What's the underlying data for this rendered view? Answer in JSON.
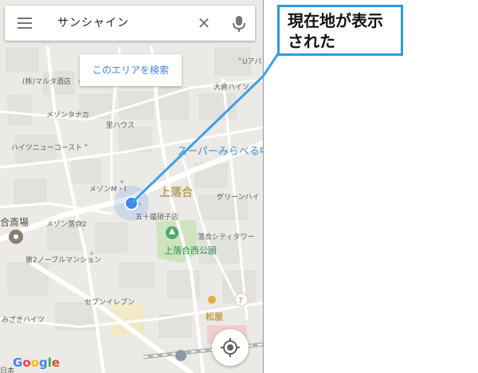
{
  "search_bar": {
    "query": "サンシャイン",
    "menu_icon": "hamburger-menu-icon",
    "clear_icon": "close-icon",
    "mic_icon": "microphone-icon",
    "clear_glyph": "✕"
  },
  "area_search": {
    "label": "このエリアを検索"
  },
  "map": {
    "places": {
      "marutaka": "(株)マルタ酒店",
      "mezon_tanaka": "メゾンタナカ",
      "sato_house": "里ハウス",
      "heights_new_coast": "ハイツニューコースト",
      "mezon_m": "メゾンM・I",
      "gojuarashi": "五十嵐硝子店",
      "mezon_ochiai": "メゾン落合2",
      "ochiai_hall": "合斎場",
      "noble_mansion": "第2ノーブルマンション",
      "seven_eleven": "セブンイレブン",
      "misaki_heights": "みざきハイツ",
      "green_heights": "グリーンハイ",
      "ochiai_city_tower": "落合シティタワー",
      "omiya_heights": "大倉ハイツ",
      "u_apa": "Uアパ",
      "nippon_fragment": "日本"
    },
    "area_label": "上落合",
    "park_label": "上落合西公園",
    "store_label": "スーパーみらべる中",
    "matsuya_label": "松屋"
  },
  "branding": {
    "google_letters": [
      "G",
      "o",
      "o",
      "g",
      "l",
      "e"
    ],
    "google_colors": [
      "#4285F4",
      "#EA4335",
      "#FBBC05",
      "#4285F4",
      "#34A853",
      "#EA4335"
    ]
  },
  "my_location_button": {
    "icon": "my-location-crosshair-icon"
  },
  "callout": {
    "line1": "現在地が表示",
    "line2": "された",
    "border_color": "#2E9BD8"
  },
  "colors": {
    "map_bg": "#EBEAE6",
    "road": "#FFFFFF",
    "park": "#CDE4BE",
    "location_dot": "#4285F4",
    "pointer_line": "#3FA0E3"
  }
}
